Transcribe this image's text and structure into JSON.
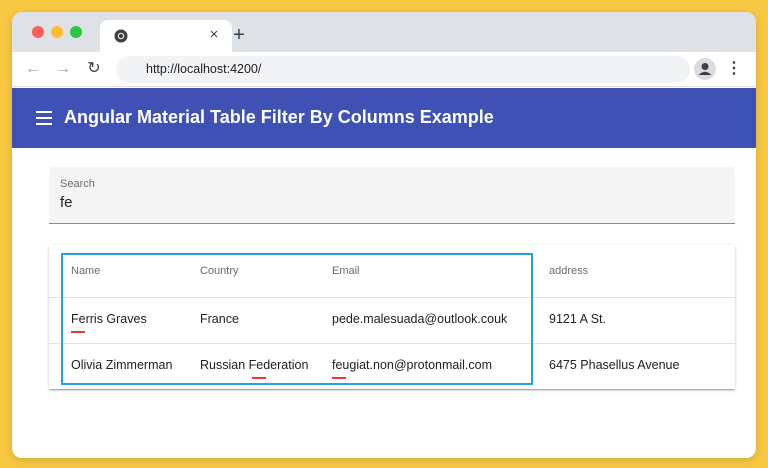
{
  "browser": {
    "tab_close": "×",
    "new_tab": "+",
    "url": "http://localhost:4200/",
    "icons": {
      "back": "back-arrow-icon",
      "forward": "forward-arrow-icon",
      "reload": "reload-icon",
      "bookmark": "star-icon",
      "profile": "profile-icon",
      "menu": "kebab-menu-icon",
      "favicon": "chrome-icon"
    }
  },
  "app": {
    "title": "Angular Material Table Filter By Columns Example",
    "toolbar_color": "#3f51b5"
  },
  "search": {
    "label": "Search",
    "value": "fe"
  },
  "table": {
    "columns": [
      "Name",
      "Country",
      "Email",
      "address"
    ],
    "rows": [
      [
        "Ferris Graves",
        "France",
        "pede.malesuada@outlook.couk",
        "9121 A St."
      ],
      [
        "Olivia Zimmerman",
        "Russian Federation",
        "feugiat.non@protonmail.com",
        "6475 Phasellus Avenue"
      ]
    ],
    "highlight_color": "#2aa0da",
    "match_underline_color": "#e53935"
  }
}
